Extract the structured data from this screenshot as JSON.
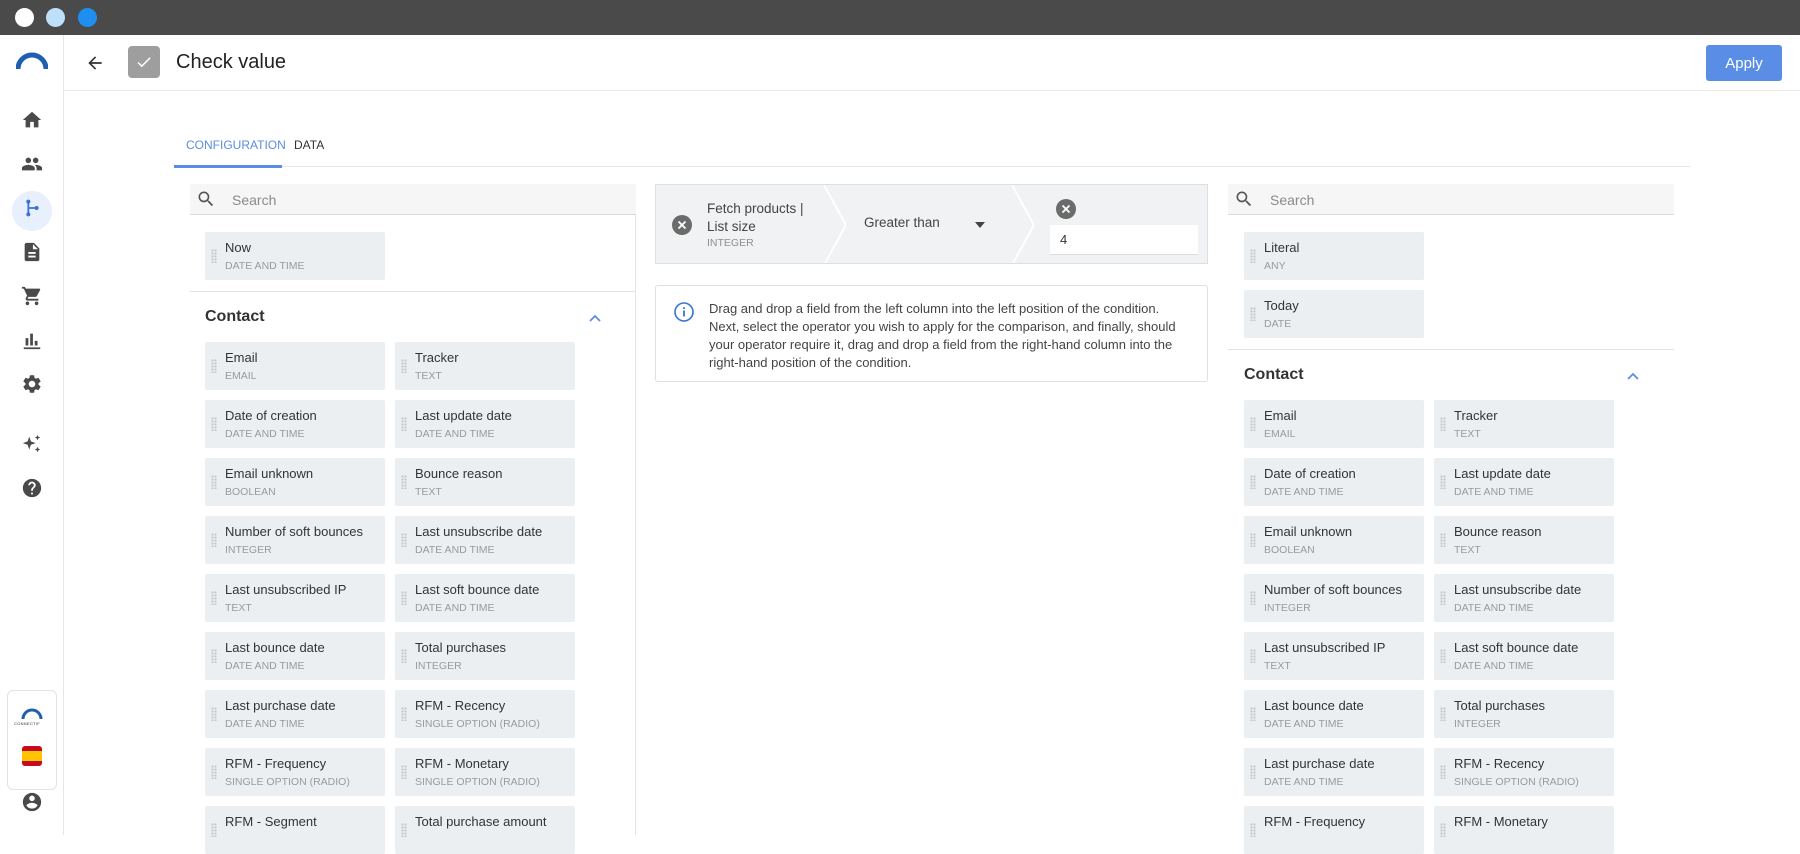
{
  "window": {
    "controls": [
      "close",
      "minimize",
      "maximize"
    ]
  },
  "sidebar": {
    "items": [
      {
        "name": "home-icon"
      },
      {
        "name": "contacts-icon"
      },
      {
        "name": "workflow-icon"
      },
      {
        "name": "document-icon"
      },
      {
        "name": "cart-icon"
      },
      {
        "name": "analytics-icon"
      },
      {
        "name": "settings-icon"
      },
      {
        "name": "sparkles-icon"
      },
      {
        "name": "help-icon"
      }
    ],
    "brand_small": "CONNECTIF",
    "language": "ES"
  },
  "header": {
    "title": "Check value",
    "apply_label": "Apply"
  },
  "tabs": [
    {
      "label": "CONFIGURATION",
      "active": true
    },
    {
      "label": "DATA",
      "active": false
    }
  ],
  "left_panel": {
    "search_placeholder": "Search",
    "top_fields": [
      {
        "name": "Now",
        "type": "DATE AND TIME"
      }
    ],
    "section_title": "Contact",
    "fields": [
      {
        "name": "Email",
        "type": "EMAIL"
      },
      {
        "name": "Tracker",
        "type": "TEXT"
      },
      {
        "name": "Date of creation",
        "type": "DATE AND TIME"
      },
      {
        "name": "Last update date",
        "type": "DATE AND TIME"
      },
      {
        "name": "Email unknown",
        "type": "BOOLEAN"
      },
      {
        "name": "Bounce reason",
        "type": "TEXT"
      },
      {
        "name": "Number of soft bounces",
        "type": "INTEGER"
      },
      {
        "name": "Last unsubscribe date",
        "type": "DATE AND TIME"
      },
      {
        "name": "Last unsubscribed IP",
        "type": "TEXT"
      },
      {
        "name": "Last soft bounce date",
        "type": "DATE AND TIME"
      },
      {
        "name": "Last bounce date",
        "type": "DATE AND TIME"
      },
      {
        "name": "Total purchases",
        "type": "INTEGER"
      },
      {
        "name": "Last purchase date",
        "type": "DATE AND TIME"
      },
      {
        "name": "RFM - Recency",
        "type": "SINGLE OPTION (RADIO)"
      },
      {
        "name": "RFM - Frequency",
        "type": "SINGLE OPTION (RADIO)"
      },
      {
        "name": "RFM - Monetary",
        "type": "SINGLE OPTION (RADIO)"
      },
      {
        "name": "RFM - Segment",
        "type": ""
      },
      {
        "name": "Total purchase amount",
        "type": ""
      }
    ]
  },
  "condition": {
    "left_field_name": "Fetch products | List size",
    "left_field_type": "INTEGER",
    "operator": "Greater than",
    "value": "4",
    "info": "Drag and drop a field from the left column into the left position of the condition. Next, select the operator you wish to apply for the comparison, and finally, should your operator require it, drag and drop a field from the right-hand column into the right-hand position of the condition."
  },
  "right_panel": {
    "search_placeholder": "Search",
    "top_fields": [
      {
        "name": "Literal",
        "type": "ANY"
      },
      {
        "name": "Today",
        "type": "DATE"
      }
    ],
    "section_title": "Contact",
    "fields": [
      {
        "name": "Email",
        "type": "EMAIL"
      },
      {
        "name": "Tracker",
        "type": "TEXT"
      },
      {
        "name": "Date of creation",
        "type": "DATE AND TIME"
      },
      {
        "name": "Last update date",
        "type": "DATE AND TIME"
      },
      {
        "name": "Email unknown",
        "type": "BOOLEAN"
      },
      {
        "name": "Bounce reason",
        "type": "TEXT"
      },
      {
        "name": "Number of soft bounces",
        "type": "INTEGER"
      },
      {
        "name": "Last unsubscribe date",
        "type": "DATE AND TIME"
      },
      {
        "name": "Last unsubscribed IP",
        "type": "TEXT"
      },
      {
        "name": "Last soft bounce date",
        "type": "DATE AND TIME"
      },
      {
        "name": "Last bounce date",
        "type": "DATE AND TIME"
      },
      {
        "name": "Total purchases",
        "type": "INTEGER"
      },
      {
        "name": "Last purchase date",
        "type": "DATE AND TIME"
      },
      {
        "name": "RFM - Recency",
        "type": "SINGLE OPTION (RADIO)"
      },
      {
        "name": "RFM - Frequency",
        "type": ""
      },
      {
        "name": "RFM - Monetary",
        "type": ""
      }
    ]
  },
  "colors": {
    "accent": "#5a8de6",
    "titlebar": "#4a4a4a",
    "card_bg": "#eceff1"
  }
}
